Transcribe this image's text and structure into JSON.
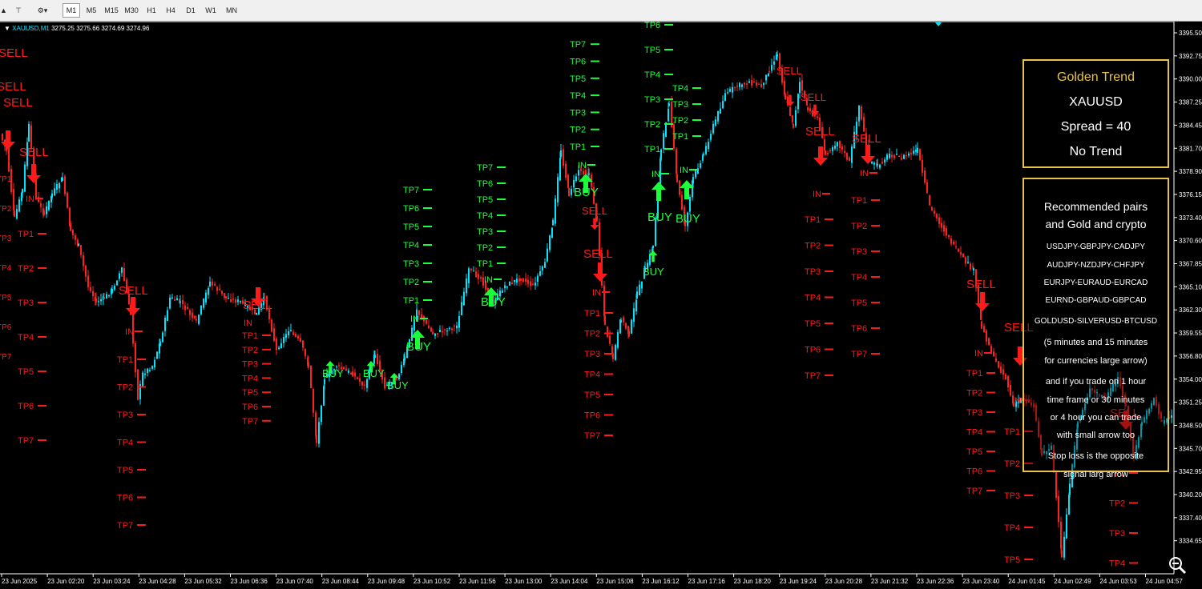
{
  "toolbar": {
    "timeframes": [
      "M1",
      "M5",
      "M15",
      "M30",
      "H1",
      "H4",
      "D1",
      "W1",
      "MN"
    ],
    "active_timeframe": "M1"
  },
  "chart": {
    "symbol": "XAUUSD,M1",
    "ohlc": "3275.25 3275.66 3274.69 3274.96",
    "background": "#000000",
    "candle_up_color": "#00e5ff",
    "candle_down_color": "#ff2020",
    "buy_color": "#1aff3a",
    "sell_color": "#ff1a1a",
    "price_labels": [
      "3395.50",
      "3392.75",
      "3390.00",
      "3387.25",
      "3384.45",
      "3381.70",
      "3378.90",
      "3376.15",
      "3373.40",
      "3370.60",
      "3367.85",
      "3365.10",
      "3362.30",
      "3359.55",
      "3356.80",
      "3354.00",
      "3351.25",
      "3348.50",
      "3345.70",
      "3342.95",
      "3340.20",
      "3337.40",
      "3334.65"
    ],
    "time_labels": [
      "23 Jun 2025",
      "23 Jun 02:20",
      "23 Jun 03:24",
      "23 Jun 04:28",
      "23 Jun 05:32",
      "23 Jun 06:36",
      "23 Jun 07:40",
      "23 Jun 08:44",
      "23 Jun 09:48",
      "23 Jun 10:52",
      "23 Jun 11:56",
      "23 Jun 13:00",
      "23 Jun 14:04",
      "23 Jun 15:08",
      "23 Jun 16:12",
      "23 Jun 17:16",
      "23 Jun 18:20",
      "23 Jun 19:24",
      "23 Jun 20:28",
      "23 Jun 21:32",
      "23 Jun 22:36",
      "23 Jun 23:40",
      "24 Jun 01:45",
      "24 Jun 02:49",
      "24 Jun 03:53",
      "24 Jun 04:57"
    ]
  },
  "signal_text": {
    "buy": "BUY",
    "sell": "SELL",
    "entry": "IN",
    "tp": [
      "TP1",
      "TP2",
      "TP3",
      "TP4",
      "TP5",
      "TP6",
      "TP7"
    ]
  },
  "info_box": {
    "title": "Golden Trend",
    "symbol": "XAUUSD",
    "spread": "Spread = 40",
    "trend": "No Trend"
  },
  "recommend_box": {
    "lines": [
      "Recommended pairs",
      "and Gold and crypto",
      "USDJPY-GBPJPY-CADJPY",
      "AUDJPY-NZDJPY-CHFJPY",
      "EURJPY-EURAUD-EURCAD",
      "EURND-GBPAUD-GBPCAD",
      "GOLDUSD-SILVERUSD-BTCUSD",
      "(5 minutes and 15 minutes",
      "for currencies large arrow)",
      "and if you trade on 1 hour",
      "time frame or 30 minutes",
      "or 4 hour you can trade",
      "with small arrow too",
      "Stop loss is the opposite",
      "signal larg arrow"
    ]
  }
}
